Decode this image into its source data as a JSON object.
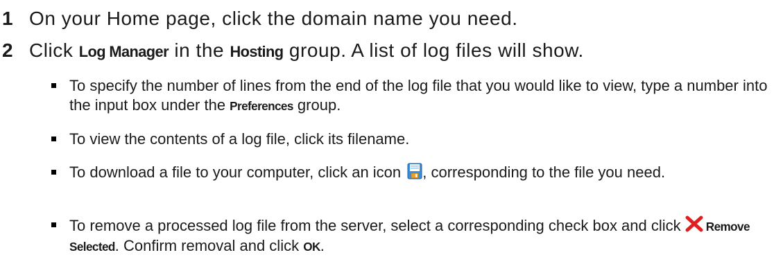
{
  "steps": [
    {
      "number": "1",
      "text": "On your Home page, click the domain name you need."
    },
    {
      "number": "2",
      "pre": "Click ",
      "ui1": "Log Manager",
      "mid": " in the ",
      "ui2": "Hosting",
      "post": " group. A list of log files will show."
    }
  ],
  "bullets": [
    {
      "pre": "To specify the number of lines from the end of the log file that you would like to view, type a number into the input box under the ",
      "ui": "Preferences",
      "post": " group."
    },
    {
      "text": "To view the contents of a log file, click its filename."
    },
    {
      "pre": "To download a file to your computer, click an icon ",
      "icon": "save-icon",
      "post": ", corresponding to the file you need."
    },
    {
      "pre": "To remove a processed log file from the server, select a corresponding check box and click ",
      "icon": "remove-icon",
      "ui1": "Remove Selected",
      "mid": ". Confirm removal and click ",
      "ui2": "OK",
      "post": "."
    }
  ],
  "colors": {
    "text": "#1a1a1a",
    "save_icon_blue": "#3b8fd9",
    "save_icon_orange": "#f0a030",
    "remove_icon_red": "#e02020"
  }
}
